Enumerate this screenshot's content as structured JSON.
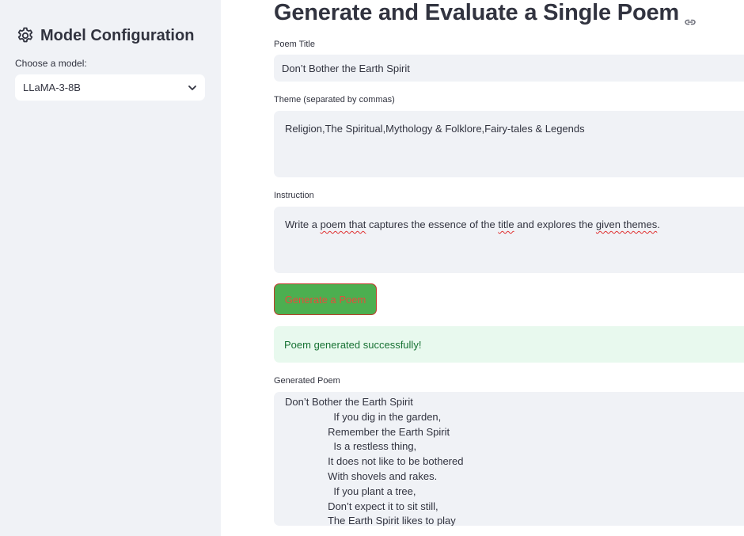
{
  "sidebar": {
    "title": "Model Configuration",
    "title_icon": "gear-icon",
    "model_label": "Choose a model:",
    "model_selected": "LLaMA-3-8B",
    "select_icon": "chevron-down-icon"
  },
  "main": {
    "page_title": "Generate and Evaluate a Single Poem",
    "title_icon": "link-icon",
    "poem_title": {
      "label": "Poem Title",
      "value": "Don’t Bother the Earth Spirit"
    },
    "theme": {
      "label": "Theme (separated by commas)",
      "value": "Religion,The Spiritual,Mythology & Folklore,Fairy-tales & Legends"
    },
    "instruction": {
      "label": "Instruction",
      "parts": [
        "Write a ",
        "poem that",
        " captures the essence of the ",
        "title",
        " and explores the ",
        "given themes",
        "."
      ]
    },
    "generate_button": "Generate a Poem",
    "success_message": "Poem generated successfully!",
    "generated_poem": {
      "label": "Generated Poem",
      "lines": [
        "Don’t Bother the Earth Spirit",
        "                 If you dig in the garden,",
        "               Remember the Earth Spirit",
        "                 Is a restless thing,",
        "               It does not like to be bothered",
        "               With shovels and rakes.",
        "                 If you plant a tree,",
        "               Don’t expect it to sit still,",
        "               The Earth Spirit likes to play"
      ]
    }
  },
  "colors": {
    "sidebar_bg": "#f0f2f6",
    "field_bg": "#f0f2f6",
    "button_bg": "#4caf50",
    "button_text": "#e74c3c",
    "success_bg": "#e8f9ee",
    "success_text": "#177233"
  }
}
